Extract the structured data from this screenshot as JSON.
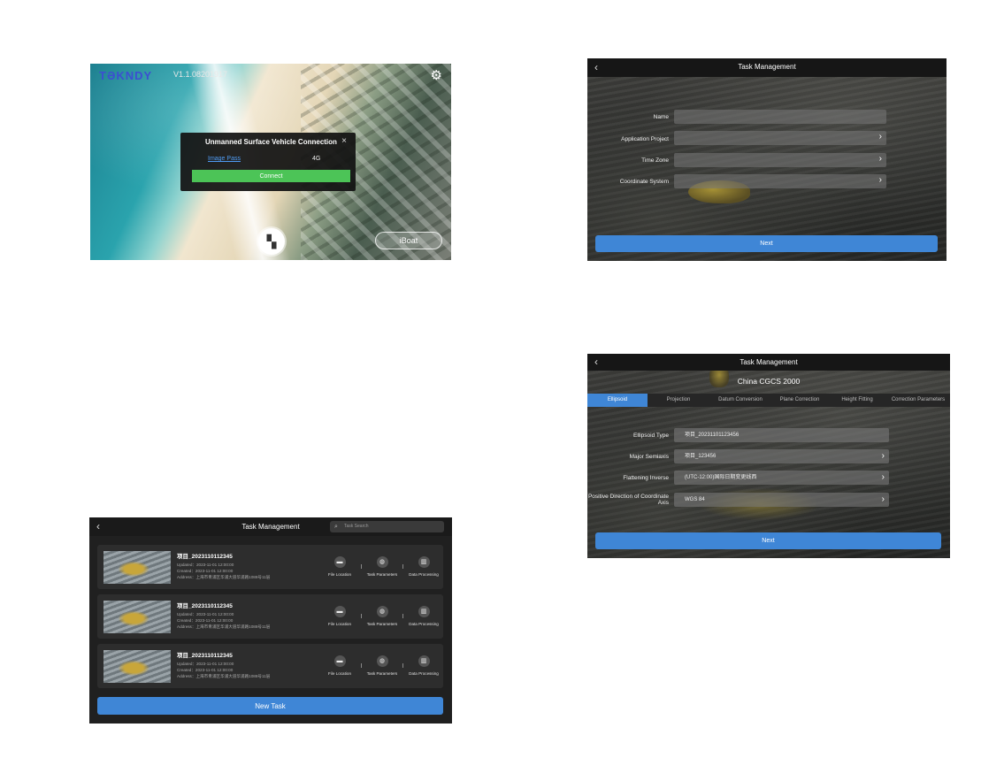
{
  "connection_screen": {
    "logo": "TƏKNDY",
    "version": "V1.1.08201917",
    "settings_icon": "gear-icon",
    "dialog": {
      "title": "Unmanned Surface Vehicle Connection",
      "close_icon": "×",
      "image_pass_label": "Image Pass",
      "network": "4G",
      "connect_label": "Connect"
    },
    "menu_icon": "grid-icon",
    "iboat_label": "iBoat"
  },
  "task_form": {
    "title": "Task Management",
    "back_icon": "‹",
    "fields": [
      {
        "label": "Name",
        "value": "",
        "has_chevron": false
      },
      {
        "label": "Application Project",
        "value": "",
        "has_chevron": true
      },
      {
        "label": "Time Zone",
        "value": "",
        "has_chevron": true
      },
      {
        "label": "Coordinate System",
        "value": "",
        "has_chevron": true
      }
    ],
    "next_label": "Next"
  },
  "task_list": {
    "title": "Task Management",
    "back_icon": "‹",
    "search_placeholder": "Task Search",
    "tasks": [
      {
        "name": "项目_2023110112345",
        "updated": "Updated：2023-11-01 12:00:00",
        "created": "Created：2023-11-01 12:00:00",
        "address": "Address：上海市青浦区华浦大道华浦路1088号11层"
      },
      {
        "name": "项目_2023110112345",
        "updated": "Updated：2023-11-01 12:00:00",
        "created": "Created：2023-11-01 12:00:00",
        "address": "Address：上海市青浦区华浦大道华浦路1088号11层"
      },
      {
        "name": "项目_2023110112345",
        "updated": "Updated：2023-11-01 12:00:00",
        "created": "Created：2023-11-01 12:00:00",
        "address": "Address：上海市青浦区华浦大道华浦路1088号11层"
      }
    ],
    "actions": {
      "file_location": "File Location",
      "task_parameters": "Task Parameters",
      "data_processing": "Data Processing"
    },
    "new_task_label": "New Task"
  },
  "coord_screen": {
    "title": "Task Management",
    "back_icon": "‹",
    "coordinate_system_name": "China CGCS 2000",
    "tabs": [
      "Ellipsoid",
      "Projection",
      "Datum Conversion",
      "Plane Correction",
      "Height Fitting",
      "Correction Parameters"
    ],
    "active_tab": "Ellipsoid",
    "fields": [
      {
        "label": "Ellipsoid Type",
        "value": "项目_20231101123456",
        "has_chevron": false
      },
      {
        "label": "Major Semiaxis",
        "value": "项目_123456",
        "has_chevron": true
      },
      {
        "label": "Flattening Inverse",
        "value": "(UTC-12:00)国际日期变更线西",
        "has_chevron": true
      },
      {
        "label": "Positive Direction of Coordinate Axis",
        "value": "WGS 84",
        "has_chevron": true
      }
    ],
    "next_label": "Next"
  },
  "colors": {
    "accent_blue": "#3f86d6",
    "connect_green": "#4cc457",
    "link_blue": "#4f9cf4"
  }
}
